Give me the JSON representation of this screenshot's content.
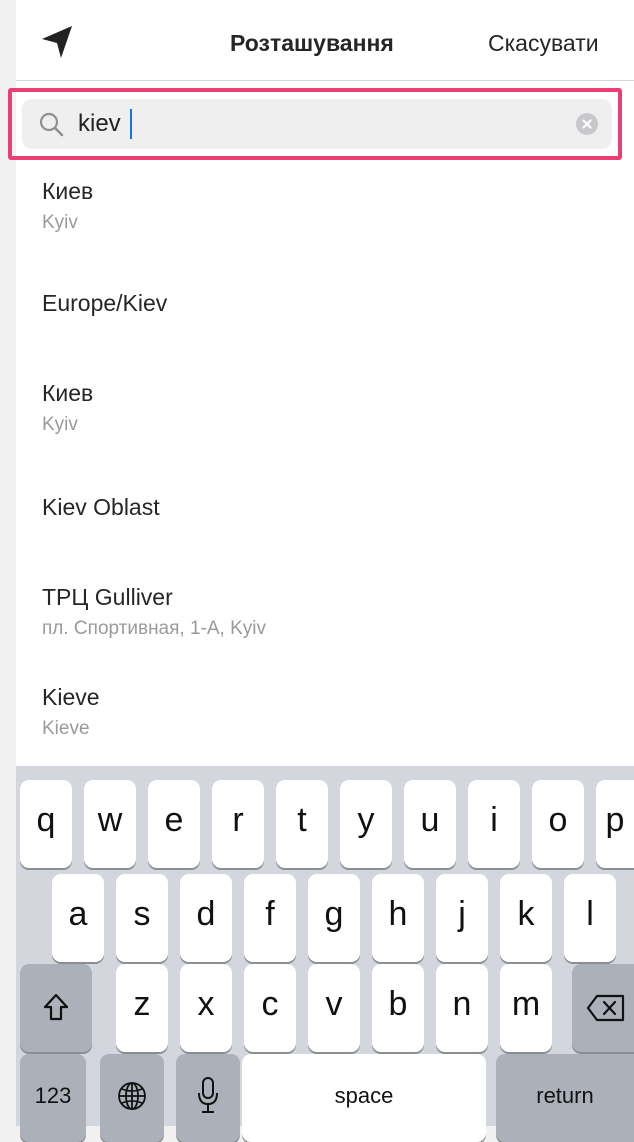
{
  "header": {
    "location_icon": "location-arrow-icon",
    "title": "Розташування",
    "cancel_label": "Скасувати"
  },
  "search": {
    "icon": "search-icon",
    "value": "kiev",
    "clear_icon": "clear-circle-icon"
  },
  "results": [
    {
      "name": "Киев",
      "subtitle": "Kyiv"
    },
    {
      "name": "Europe/Kiev",
      "subtitle": ""
    },
    {
      "name": "Киев",
      "subtitle": "Kyiv"
    },
    {
      "name": "Kiev Oblast",
      "subtitle": ""
    },
    {
      "name": "ТРЦ Gulliver",
      "subtitle": "пл. Спортивная, 1-А, Kyiv"
    },
    {
      "name": "Kieve",
      "subtitle": "Kieve"
    }
  ],
  "keyboard": {
    "row1": [
      "q",
      "w",
      "e",
      "r",
      "t",
      "y",
      "u",
      "i",
      "o",
      "p"
    ],
    "row2": [
      "a",
      "s",
      "d",
      "f",
      "g",
      "h",
      "j",
      "k",
      "l"
    ],
    "row3": [
      "z",
      "x",
      "c",
      "v",
      "b",
      "n",
      "m"
    ],
    "numbers_label": "123",
    "space_label": "space",
    "return_label": "return",
    "shift_icon": "shift-icon",
    "backspace_icon": "backspace-icon",
    "globe_icon": "globe-icon",
    "mic_icon": "microphone-icon"
  }
}
